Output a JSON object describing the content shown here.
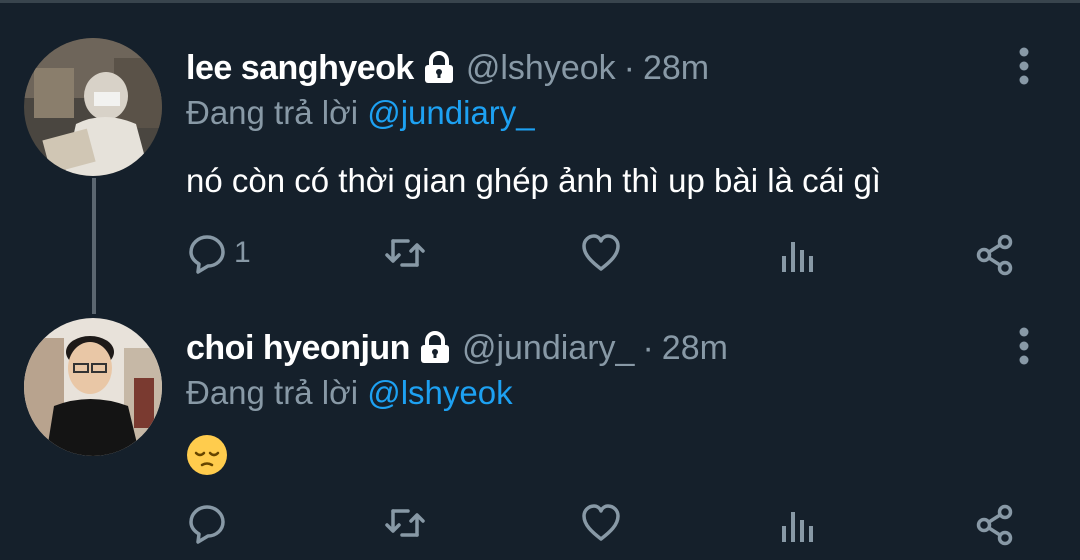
{
  "tweets": [
    {
      "display_name": "lee sanghyeok",
      "handle": "@lshyeok",
      "separator": "·",
      "time": "28m",
      "reply_prefix": "Đang trả lời",
      "reply_to": "@jundiary_",
      "text": "nó còn có thời gian ghép ảnh thì up bài là cái gì",
      "reply_count": "1",
      "avatar": "avatar-photo-reading",
      "protected": true
    },
    {
      "display_name": "choi hyeonjun",
      "handle": "@jundiary_",
      "separator": "·",
      "time": "28m",
      "reply_prefix": "Đang trả lời",
      "reply_to": "@lshyeok",
      "emoji": "😔",
      "emoji_name": "pensive-face",
      "reply_count": "",
      "avatar": "avatar-photo-glasses",
      "protected": true
    }
  ],
  "icons": [
    "lock-icon",
    "more-vertical-icon",
    "reply-icon",
    "retweet-icon",
    "like-icon",
    "analytics-icon",
    "share-icon"
  ],
  "colors": {
    "background": "#15202b",
    "text": "#ffffff",
    "muted": "#8899a6",
    "mention": "#1da1f2",
    "thread_line": "#5b6670"
  }
}
